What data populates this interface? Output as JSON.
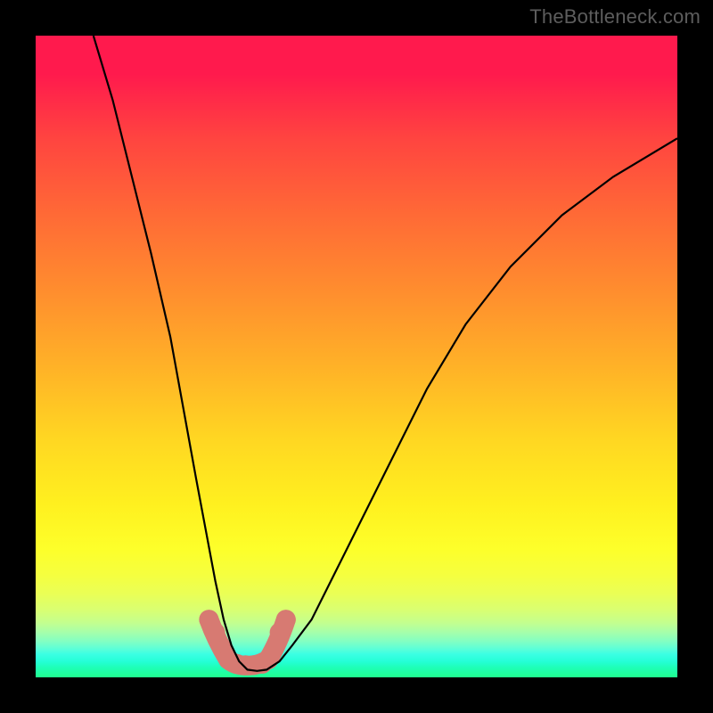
{
  "watermark": "TheBottleneck.com",
  "chart_data": {
    "type": "line",
    "title": "",
    "xlabel": "",
    "ylabel": "",
    "xlim": [
      0,
      100
    ],
    "ylim": [
      0,
      100
    ],
    "series": [
      {
        "name": "black-curve",
        "color": "#000000",
        "x": [
          9,
          12,
          15,
          18,
          21,
          23,
          25,
          26.5,
          28,
          29.3,
          30.5,
          31.7,
          33,
          34.5,
          36,
          38,
          40,
          43,
          46,
          50,
          55,
          61,
          67,
          74,
          82,
          90,
          100
        ],
        "y": [
          100,
          90,
          78,
          66,
          53,
          42,
          31,
          23,
          15,
          9,
          5,
          2.5,
          1.2,
          1,
          1.2,
          2.5,
          5,
          9,
          15,
          23,
          33,
          45,
          55,
          64,
          72,
          78,
          84
        ]
      },
      {
        "name": "bottom-marker-nodes",
        "color": "#d77a72",
        "type": "scatter",
        "x": [
          27.0,
          28.0,
          30.0,
          31.4,
          32.7,
          34.0,
          35.3,
          36.3,
          38.0,
          39.0
        ],
        "y": [
          9.0,
          7.0,
          2.8,
          2.1,
          1.9,
          1.9,
          2.1,
          2.8,
          7.0,
          9.0
        ]
      }
    ],
    "gradient_stops_top_to_bottom": [
      {
        "pos": 0.0,
        "color": "#ff1a4d"
      },
      {
        "pos": 0.5,
        "color": "#ffb327"
      },
      {
        "pos": 0.8,
        "color": "#fdff2a"
      },
      {
        "pos": 1.0,
        "color": "#20ff8f"
      }
    ]
  }
}
